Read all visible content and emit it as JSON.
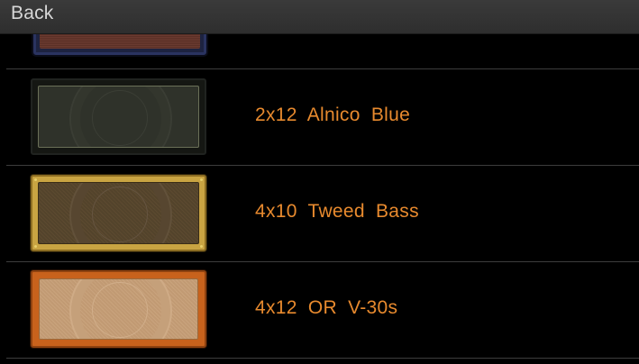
{
  "nav": {
    "back_label": "Back"
  },
  "theme": {
    "label_color": "#e88a2e",
    "divider_color": "#3d3d3d",
    "top_bar_color": "#333333"
  },
  "cabinets": [
    {
      "label": "",
      "style": "red-navy-partial"
    },
    {
      "label": "2x12 Alnico Blue",
      "style": "dark-olive-grill"
    },
    {
      "label": "4x10 Tweed Bass",
      "style": "tweed-gold-frame"
    },
    {
      "label": "4x12 OR V-30s",
      "style": "orange-tolex-beige-grill"
    }
  ]
}
